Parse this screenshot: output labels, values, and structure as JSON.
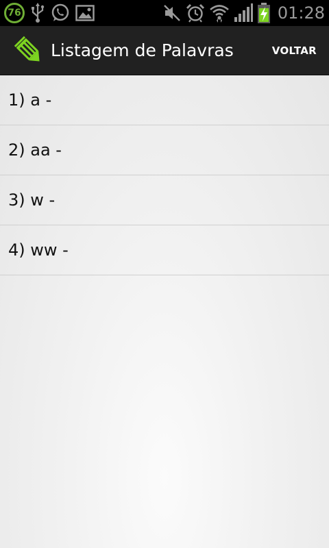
{
  "status_bar": {
    "battery_badge": "76",
    "time": "01:28",
    "icons": [
      "usb-icon",
      "whatsapp-icon",
      "gallery-icon",
      "mute-icon",
      "alarm-icon",
      "wifi-icon",
      "signal-icon",
      "battery-charging-icon"
    ],
    "colors": {
      "badge": "#6fae35",
      "battery": "#7dd321"
    }
  },
  "action_bar": {
    "title": "Listagem de Palavras",
    "back_label": "VOLTAR",
    "app_icon": "pencil-icon",
    "app_icon_color": "#7dd321"
  },
  "list": {
    "items": [
      {
        "label": "1) a -"
      },
      {
        "label": "2) aa -"
      },
      {
        "label": "3) w -"
      },
      {
        "label": "4) ww -"
      }
    ]
  }
}
